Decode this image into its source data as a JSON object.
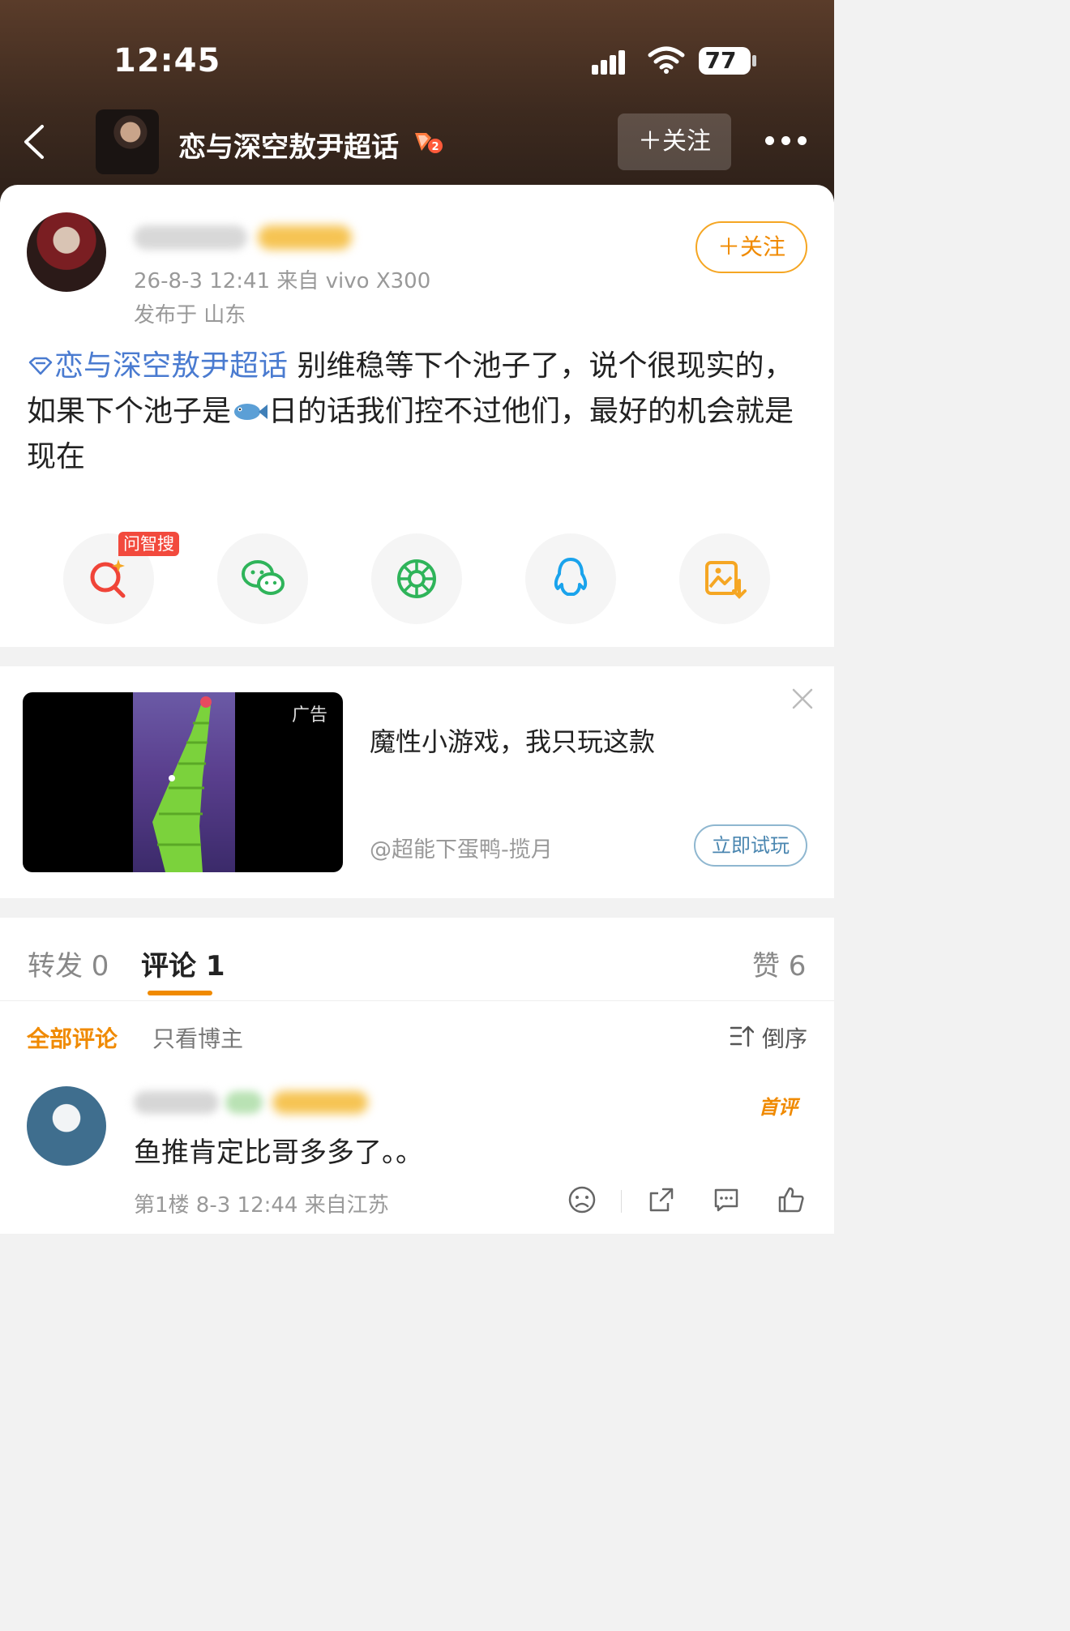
{
  "status_bar": {
    "time": "12:45",
    "battery": "77"
  },
  "header": {
    "topic_title": "恋与深空敖尹超话",
    "follow_label": "＋关注"
  },
  "post": {
    "meta": "26-8-3 12:41  来自 vivo X300",
    "location": "发布于 山东",
    "follow_label": "＋关注",
    "topic_tag": "恋与深空敖尹超话",
    "text_part1": " 别维稳等下个池子了，说个很现实的，如果下个池子是",
    "text_part2": "日的话我们控不过他们，最好的机会就是现在"
  },
  "share": {
    "ai_search_badge": "问智搜",
    "buttons": [
      "ai-search-icon",
      "wechat-icon",
      "moments-icon",
      "qq-icon",
      "save-image-icon"
    ]
  },
  "ad": {
    "label": "广告",
    "title": "魔性小游戏，我只玩这款",
    "source": "@超能下蛋鸭-揽月",
    "cta": "立即试玩"
  },
  "comments": {
    "tabs": {
      "repost": "转发 0",
      "comment": "评论 1",
      "likes": "赞 6"
    },
    "filters": {
      "all": "全部评论",
      "author_only": "只看博主",
      "sort": "倒序"
    },
    "items": [
      {
        "badge": "首评",
        "text": "鱼推肯定比哥多多了。。",
        "meta": "第1楼 8-3 12:44 来自江苏"
      }
    ]
  },
  "colors": {
    "accent": "#f08a00",
    "topic_link": "#4a7bd0",
    "ad_cta": "#4a86b0"
  }
}
